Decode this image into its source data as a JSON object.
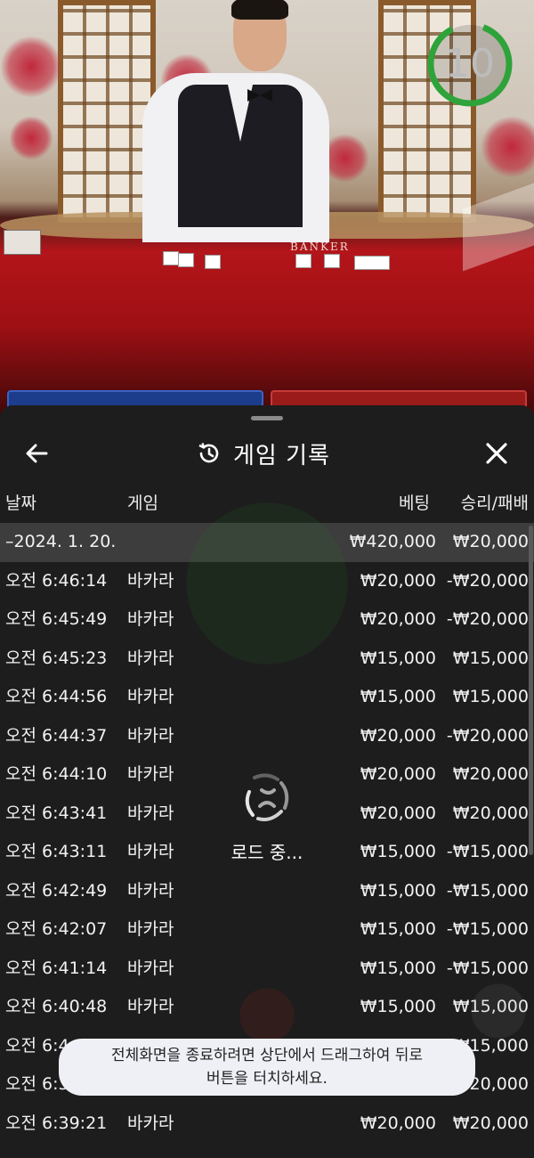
{
  "timer": {
    "value": "10"
  },
  "video": {
    "table_text": "BANKER"
  },
  "history": {
    "title": "게임 기록",
    "columns": {
      "date": "날짜",
      "game": "게임",
      "bet": "베팅",
      "win_loss": "승리/패배"
    },
    "summary": {
      "date": "–2024. 1. 20.",
      "bet": "₩420,000",
      "win_loss": "₩20,000"
    },
    "rows": [
      {
        "time": "오전 6:46:14",
        "game": "바카라",
        "bet": "₩20,000",
        "result": "-₩20,000"
      },
      {
        "time": "오전 6:45:49",
        "game": "바카라",
        "bet": "₩20,000",
        "result": "-₩20,000"
      },
      {
        "time": "오전 6:45:23",
        "game": "바카라",
        "bet": "₩15,000",
        "result": "₩15,000"
      },
      {
        "time": "오전 6:44:56",
        "game": "바카라",
        "bet": "₩15,000",
        "result": "₩15,000"
      },
      {
        "time": "오전 6:44:37",
        "game": "바카라",
        "bet": "₩20,000",
        "result": "-₩20,000"
      },
      {
        "time": "오전 6:44:10",
        "game": "바카라",
        "bet": "₩20,000",
        "result": "₩20,000"
      },
      {
        "time": "오전 6:43:41",
        "game": "바카라",
        "bet": "₩20,000",
        "result": "₩20,000"
      },
      {
        "time": "오전 6:43:11",
        "game": "바카라",
        "bet": "₩15,000",
        "result": "-₩15,000"
      },
      {
        "time": "오전 6:42:49",
        "game": "바카라",
        "bet": "₩15,000",
        "result": "-₩15,000"
      },
      {
        "time": "오전 6:42:07",
        "game": "바카라",
        "bet": "₩15,000",
        "result": "-₩15,000"
      },
      {
        "time": "오전 6:41:14",
        "game": "바카라",
        "bet": "₩15,000",
        "result": "-₩15,000"
      },
      {
        "time": "오전 6:40:48",
        "game": "바카라",
        "bet": "₩15,000",
        "result": "₩15,000"
      },
      {
        "time": "오전 6:4",
        "game": "",
        "bet": "",
        "result": "₩15,000"
      },
      {
        "time": "오전 6:3",
        "game": "",
        "bet": "",
        "result": "₩20,000"
      },
      {
        "time": "오전 6:39:21",
        "game": "바카라",
        "bet": "₩20,000",
        "result": "₩20,000"
      }
    ]
  },
  "loading": {
    "text": "로드 중..."
  },
  "toast": {
    "line1": "전체화면을 종료하려면 상단에서 드래그하여 뒤로",
    "line2": "버튼을 터치하세요."
  },
  "colors": {
    "sheet_bg": "#1d1d1d",
    "summary_bg": "#3d3d3d",
    "timer_green": "#2ea33a",
    "toast_bg": "#eef0f5"
  },
  "icons": {
    "back": "arrow-left-icon",
    "history": "history-clock-icon",
    "close": "close-icon",
    "loader": "spinner-icon"
  }
}
